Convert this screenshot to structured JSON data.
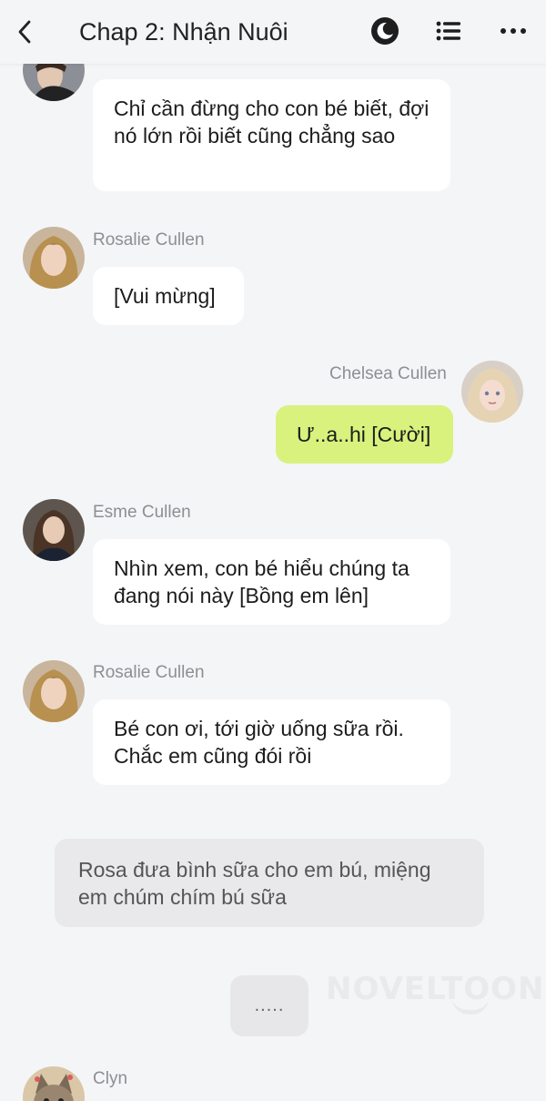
{
  "header": {
    "title": "Chap 2: Nhận Nuôi",
    "back_icon": "chevron-left-icon",
    "night_icon": "moon-icon",
    "list_icon": "list-icon",
    "more_icon": "more-icon"
  },
  "messages": [
    {
      "sender": "",
      "text": "Chỉ cần đừng cho con bé biết, đợi nó lớn rồi biết cũng chẳng sao",
      "mine": false
    },
    {
      "sender": "Rosalie Cullen",
      "text": "[Vui mừng]",
      "mine": false
    },
    {
      "sender": "Chelsea Cullen",
      "text": "Ư..a..hi [Cười]",
      "mine": true
    },
    {
      "sender": "Esme Cullen",
      "text": "Nhìn xem, con bé hiểu chúng ta đang nói này [Bồng em lên]",
      "mine": false
    },
    {
      "sender": "Rosalie Cullen",
      "text": "Bé con ơi, tới giờ uống sữa rồi. Chắc em cũng đói rồi",
      "mine": false
    }
  ],
  "narration": "Rosa đưa bình sữa cho em bú, miệng em chúm chím bú sữa",
  "typing": ".....",
  "watermark": "NOVELTOON",
  "last_sender": "Clyn",
  "colors": {
    "my_bubble": "#d8f27d",
    "other_bubble": "#ffffff",
    "background": "#f4f5f7"
  }
}
